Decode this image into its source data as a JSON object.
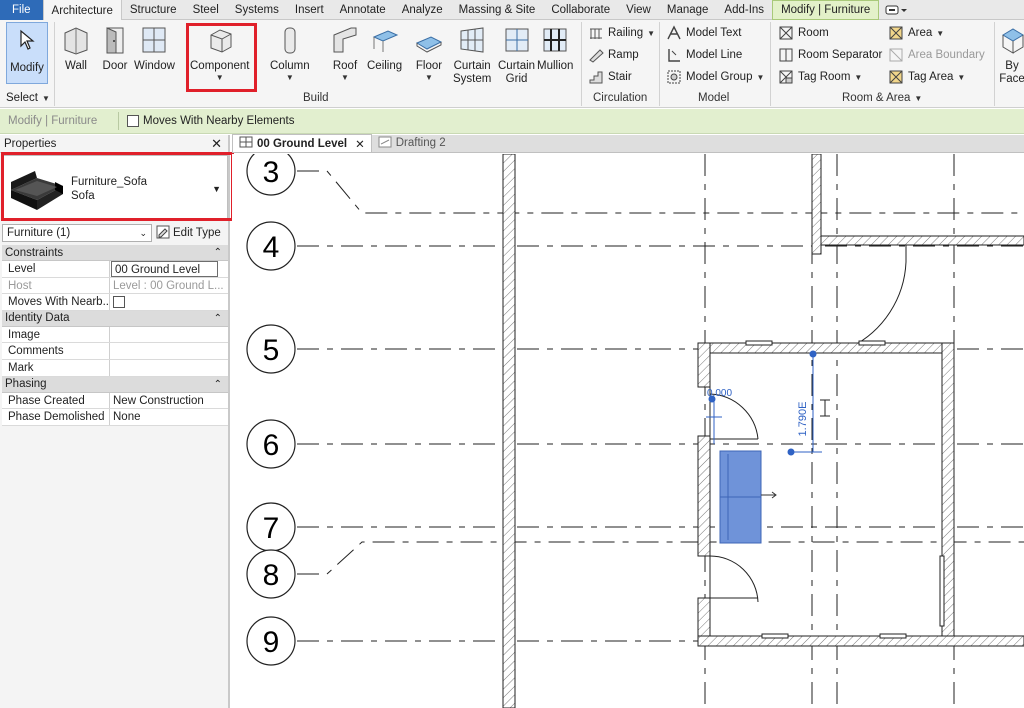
{
  "ribbon_tabs": [
    {
      "label": "File",
      "kind": "file"
    },
    {
      "label": "Architecture",
      "kind": "active"
    },
    {
      "label": "Structure",
      "kind": "normal"
    },
    {
      "label": "Steel",
      "kind": "normal"
    },
    {
      "label": "Systems",
      "kind": "normal"
    },
    {
      "label": "Insert",
      "kind": "normal"
    },
    {
      "label": "Annotate",
      "kind": "normal"
    },
    {
      "label": "Analyze",
      "kind": "normal"
    },
    {
      "label": "Massing & Site",
      "kind": "normal"
    },
    {
      "label": "Collaborate",
      "kind": "normal"
    },
    {
      "label": "View",
      "kind": "normal"
    },
    {
      "label": "Manage",
      "kind": "normal"
    },
    {
      "label": "Add-Ins",
      "kind": "normal"
    },
    {
      "label": "Modify | Furniture",
      "kind": "contextual"
    }
  ],
  "ribbon": {
    "modify": "Modify",
    "select": "Select",
    "build": {
      "wall": "Wall",
      "door": "Door",
      "window": "Window",
      "component": "Component",
      "column": "Column",
      "roof": "Roof",
      "ceiling": "Ceiling",
      "floor": "Floor",
      "curtain_system": "Curtain\nSystem",
      "curtain_grid": "Curtain\nGrid",
      "mullion": "Mullion",
      "panel": "Build"
    },
    "circulation": {
      "railing": "Railing",
      "ramp": "Ramp",
      "stair": "Stair",
      "panel": "Circulation"
    },
    "model": {
      "model_text": "Model Text",
      "model_line": "Model Line",
      "model_group": "Model Group",
      "panel": "Model"
    },
    "room_area": {
      "room": "Room",
      "room_separator": "Room Separator",
      "tag_room": "Tag Room",
      "area": "Area",
      "area_boundary": "Area Boundary",
      "tag_area": "Tag Area",
      "panel": "Room & Area"
    },
    "by_face": "By\nFace"
  },
  "options_bar": {
    "context": "Modify | Furniture",
    "moves_with_nearby": "Moves With Nearby Elements"
  },
  "properties": {
    "title": "Properties",
    "family": "Furniture_Sofa",
    "type": "Sofa",
    "instance_filter": "Furniture (1)",
    "edit_type": "Edit Type",
    "groups": [
      {
        "name": "Constraints",
        "rows": [
          {
            "name": "Level",
            "value": "00 Ground Level",
            "style": "boxed"
          },
          {
            "name": "Host",
            "value": "Level : 00 Ground L...",
            "style": "grey"
          },
          {
            "name": "Moves With Nearb...",
            "value": "",
            "style": "checkbox"
          }
        ]
      },
      {
        "name": "Identity Data",
        "rows": [
          {
            "name": "Image",
            "value": "",
            "style": "normal"
          },
          {
            "name": "Comments",
            "value": "",
            "style": "normal"
          },
          {
            "name": "Mark",
            "value": "",
            "style": "normal"
          }
        ]
      },
      {
        "name": "Phasing",
        "rows": [
          {
            "name": "Phase Created",
            "value": "New Construction",
            "style": "normal"
          },
          {
            "name": "Phase Demolished",
            "value": "None",
            "style": "normal"
          }
        ]
      }
    ]
  },
  "view_tabs": [
    {
      "label": "00 Ground Level",
      "active": true
    },
    {
      "label": "Drafting 2",
      "active": false
    }
  ],
  "canvas": {
    "grid_bubbles": [
      "3",
      "4",
      "5",
      "6",
      "7",
      "8",
      "9"
    ],
    "dim_vertical": "1.790E",
    "dim_horizontal": "0.000",
    "selection_color": "#6f93d9",
    "highlight_color": "#e0202a"
  }
}
